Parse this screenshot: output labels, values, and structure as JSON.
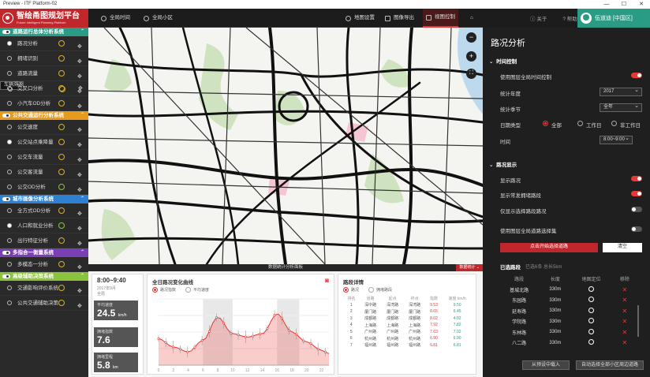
{
  "window": {
    "title": "Preview - ITF Platform-02",
    "controls": [
      "—",
      "☐",
      "✕"
    ]
  },
  "logo": {
    "title": "智绘甬图规划平台",
    "subtitle": "Future Intelligent Planning Platform"
  },
  "toolbar": {
    "time": "全局时间",
    "area": "全局小区",
    "map_settings": "地图设置",
    "export": "图像导出",
    "view": "视图控制"
  },
  "header_right": {
    "about": "关于",
    "help": "帮助",
    "user": "伍道迪 [中国区]"
  },
  "sidebar": {
    "sections": [
      {
        "title": "道路运行总体分析系统",
        "color": "#2a9b84",
        "items": [
          {
            "label": "路况分析",
            "on": true
          },
          {
            "label": "拥堵识别",
            "on": false
          },
          {
            "label": "道路流量",
            "on": false
          },
          {
            "label": "车辆溯源",
            "on": false,
            "sel": true
          },
          {
            "label": "交叉口分析",
            "on": false
          },
          {
            "label": "小汽车OD分析",
            "on": false
          }
        ]
      },
      {
        "title": "公共交通运行分析系统",
        "color": "#e69a1e",
        "items": [
          {
            "label": "公交速度",
            "on": false
          },
          {
            "label": "公交站点乘降量",
            "on": true
          },
          {
            "label": "公交车流量",
            "on": false
          },
          {
            "label": "公交客流量",
            "on": false
          },
          {
            "label": "公交OD分析",
            "on": false
          }
        ]
      },
      {
        "title": "城市画像分析系统",
        "color": "#2f80d0",
        "items": [
          {
            "label": "全方式OD分析",
            "on": false
          },
          {
            "label": "人口和就业分析",
            "on": true
          },
          {
            "label": "出行特征分析",
            "on": false
          }
        ]
      },
      {
        "title": "多指合一衡量系统",
        "color": "#7a3fb5",
        "items": [
          {
            "label": "多模态一分析",
            "on": false
          }
        ]
      },
      {
        "title": "高级辅助决策系统",
        "color": "#8cc33e",
        "items": [
          {
            "label": "交通影响评价系统",
            "on": false
          },
          {
            "label": "公共交通辅助决策",
            "on": false
          }
        ]
      }
    ]
  },
  "bottom": {
    "title": "数据统计分析面板",
    "dock_label": "数据统计",
    "time_range": "8:00~9:40",
    "date": "2017年9月",
    "scope": "全局",
    "kpis": [
      {
        "label": "平均速度",
        "value": "24.5",
        "unit": "km/h"
      },
      {
        "label": "拥堵指数",
        "value": "7.6",
        "unit": ""
      },
      {
        "label": "拥堵里程",
        "value": "5.8",
        "unit": "km"
      }
    ],
    "chart": {
      "title": "全日路况变化曲线",
      "opt1": "路况指数",
      "opt2": "平均速度",
      "xticks": [
        "0",
        "2",
        "4",
        "6",
        "8",
        "10",
        "12",
        "14",
        "16",
        "18",
        "20",
        "22"
      ]
    },
    "detail": {
      "title": "路段详情",
      "opt1": "路况",
      "opt2": "拥堵路段",
      "headers": [
        "排名",
        "道路",
        "起点",
        "终点",
        "指数",
        "速度 km/h"
      ],
      "rows": [
        [
          "1",
          "深中路",
          "深湾路",
          "深湾路",
          "9.53",
          "9.50"
        ],
        [
          "2",
          "厦门路",
          "厦门路",
          "厦门路",
          "8.65",
          "6.45"
        ],
        [
          "3",
          "成都路",
          "成都路",
          "成都路",
          "8.02",
          "4.02"
        ],
        [
          "4",
          "上海路",
          "上海路",
          "上海路",
          "7.92",
          "7.82"
        ],
        [
          "5",
          "广州路",
          "广州路",
          "广州路",
          "7.63",
          "7.02"
        ],
        [
          "6",
          "杭州路",
          "杭州路",
          "杭州路",
          "6.90",
          "6.90"
        ],
        [
          "7",
          "福州路",
          "福州路",
          "福州路",
          "6.81",
          "6.81"
        ]
      ]
    }
  },
  "chart_data": {
    "type": "area",
    "title": "全日路况变化曲线",
    "x": [
      0,
      2,
      4,
      6,
      8,
      10,
      12,
      14,
      16,
      18,
      20,
      22,
      23
    ],
    "values": [
      3.2,
      2.2,
      1.6,
      3,
      5.8,
      3.8,
      3.4,
      3.8,
      6.2,
      4,
      2.8,
      1.8,
      1.4
    ],
    "ylim": [
      0,
      8
    ]
  },
  "right": {
    "title": "路况分析",
    "time_section": "时间控制",
    "use_global_time": "使用图层全局时间控制",
    "year_label": "统计年度",
    "year": "2017",
    "season_label": "统计季节",
    "season": "全年",
    "daytype_label": "日期类型",
    "daytype_opts": [
      "全部",
      "工作日",
      "非工作日"
    ],
    "time_label": "时间",
    "time_value": "8:00~9:00",
    "display_section": "路况显示",
    "show_status": "显示路况",
    "show_congest": "显示常发拥堵路段",
    "only_selected": "仅显示选择路段路况",
    "use_global_sel": "使用图层全局道路选择集",
    "btn_select": "点击开始选择道路",
    "btn_clear": "清空",
    "selected_title": "已选路段",
    "selected_count": "已选6条 总长5km",
    "table_headers": [
      "路段",
      "长度",
      "地图定位",
      "移除"
    ],
    "rows": [
      [
        "基城北路",
        "330m"
      ],
      [
        "东园路",
        "330m"
      ],
      [
        "延寿路",
        "330m"
      ],
      [
        "学院路",
        "330m"
      ],
      [
        "东林路",
        "330m"
      ],
      [
        "八二路",
        "330m"
      ]
    ],
    "btn_import": "从预设中载入",
    "btn_auto": "自动选择全部小区周边道路"
  }
}
